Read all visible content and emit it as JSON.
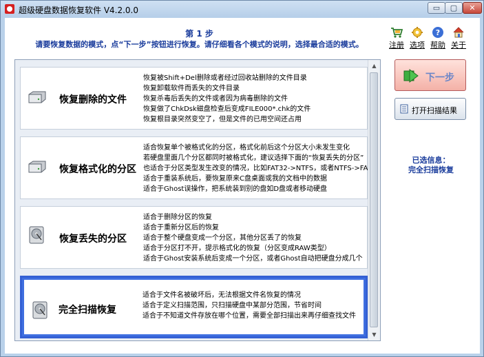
{
  "window": {
    "title": "超级硬盘数据恢复软件 V4.2.0.0",
    "controls": {
      "minimize": "▭",
      "maximize": "▢",
      "close": "✕"
    }
  },
  "header": {
    "step": "第 1 步",
    "instruction": "请要恢复数据的模式，点“下一步”按钮进行恢复。请仔细看各个模式的说明，选择最合适的模式。"
  },
  "toolbar": {
    "items": [
      {
        "label": "注册",
        "icon": "cart-icon"
      },
      {
        "label": "选项",
        "icon": "gear-icon"
      },
      {
        "label": "帮助",
        "icon": "help-icon"
      },
      {
        "label": "关于",
        "icon": "home-icon"
      }
    ]
  },
  "options": [
    {
      "title": "恢复删除的文件",
      "lines": [
        "恢复被Shift+Del删除或者经过回收站删除的文件目录",
        "恢复卸载软件而丢失的文件目录",
        "恢复杀毒后丢失的文件或者因为病毒删除的文件",
        "恢复做了ChkDsk磁盘检查后变成FILE000*.chk的文件",
        "恢复根目录突然变空了，但是文件的已用空间还占用"
      ]
    },
    {
      "title": "恢复格式化的分区",
      "lines": [
        "适合恢复单个被格式化的分区，格式化前后这个分区大小未发生变化",
        "若硬盘里面几个分区都同时被格式化，建议选择下面的“恢复丢失的分区”",
        "也适合于分区类型发生改变的情况，比如FAT32->NTFS，或者NTFS->FA",
        "适合于重装系统后，要恢复原来C盘桌面或我的文档中的数据",
        "适合于Ghost误操作，把系统装到别的盘如D盘或者移动硬盘"
      ]
    },
    {
      "title": "恢复丢失的分区",
      "lines": [
        "适合于删除分区的恢复",
        "适合于重新分区后的恢复",
        "适合于整个硬盘变成一个分区，其他分区丢了的恢复",
        "适合于分区打不开，提示格式化的恢复（分区变成RAW类型）",
        "适合于Ghost安装系统后变成一个分区，或者Ghost自动把硬盘分成几个"
      ]
    },
    {
      "title": "完全扫描恢复",
      "lines": [
        "适合于文件名被破坏后，无法根据文件名恢复的情况",
        "适合于定义扫描范围，只扫描硬盘中某部分范围，节省时间",
        "适合于不知道文件存放在哪个位置，需要全部扫描出来再仔细查找文件"
      ]
    }
  ],
  "selected_index": 3,
  "side": {
    "next_label": "下一步",
    "open_results_label": "打开扫描结果",
    "selected_info_label": "已选信息：",
    "selected_info_value": "完全扫描恢复"
  },
  "scrollbar": {
    "up": "▲",
    "down": "▼"
  },
  "colors": {
    "accent": "#1a3c9c",
    "selection": "#3f6fe0",
    "next_button": "#f4b1a7"
  }
}
